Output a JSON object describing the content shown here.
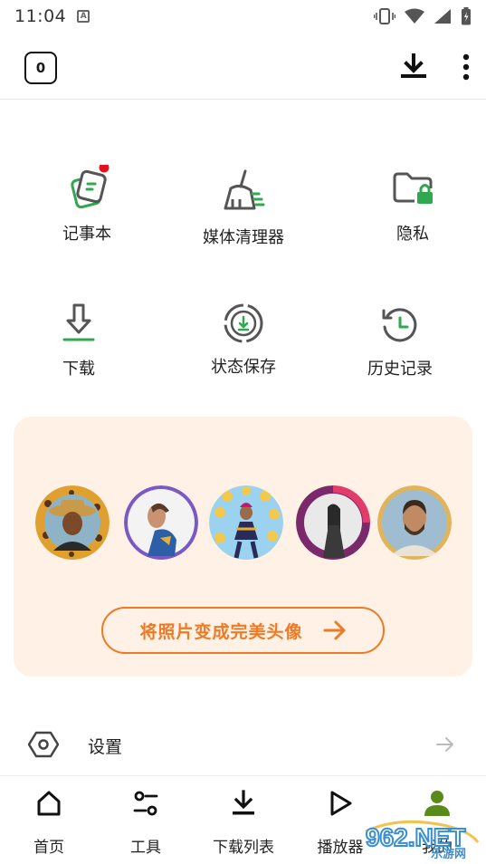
{
  "status_bar": {
    "time": "11:04"
  },
  "top_bar": {
    "tab_count": "0"
  },
  "tools": [
    {
      "label": "记事本",
      "icon": "notepad-icon",
      "badge": true
    },
    {
      "label": "媒体清理器",
      "icon": "broom-icon"
    },
    {
      "label": "隐私",
      "icon": "private-folder-icon"
    },
    {
      "label": "下载",
      "icon": "download-icon"
    },
    {
      "label": "状态保存",
      "icon": "status-saver-icon"
    },
    {
      "label": "历史记录",
      "icon": "history-icon"
    }
  ],
  "avatar_card": {
    "button_label": "将照片变成完美头像",
    "avatars": [
      "leopard-frame",
      "purple-ring",
      "flower-frame",
      "magenta-ring",
      "gold-ring"
    ]
  },
  "settings": {
    "label": "设置"
  },
  "bottom_nav": [
    {
      "label": "首页",
      "icon": "home-icon"
    },
    {
      "label": "工具",
      "icon": "tools-icon"
    },
    {
      "label": "下载列表",
      "icon": "download-list-icon"
    },
    {
      "label": "播放器",
      "icon": "player-icon"
    },
    {
      "label": "我的",
      "icon": "profile-icon",
      "active": true
    }
  ],
  "colors": {
    "green": "#2fa84f",
    "orange": "#ef7a26",
    "card_bg": "#fff1e5",
    "badge_red": "#e5101d",
    "profile_green": "#5a8a1a"
  },
  "watermark": {
    "text": "962.NET",
    "subtext": "乐游网"
  }
}
